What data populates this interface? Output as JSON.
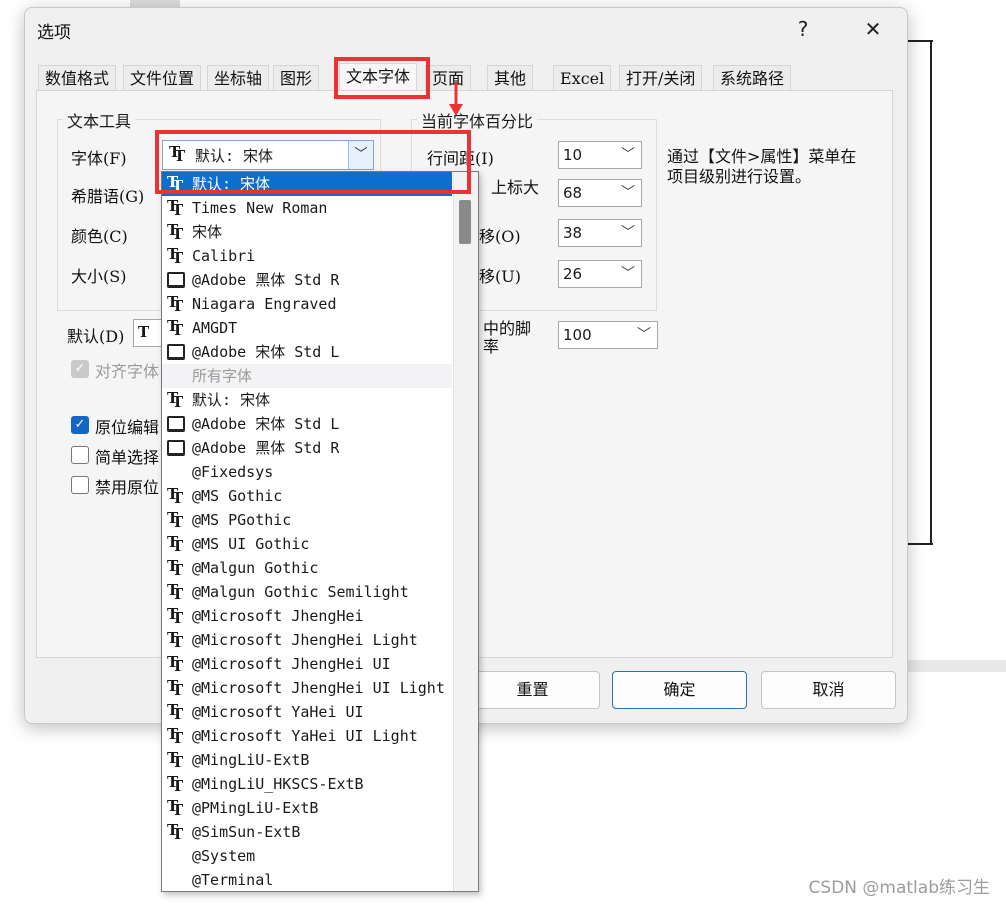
{
  "dialog": {
    "title": "选项",
    "help_label": "?",
    "close_label": "✕"
  },
  "tabs": [
    {
      "label": "数值格式"
    },
    {
      "label": "文件位置"
    },
    {
      "label": "坐标轴"
    },
    {
      "label": "图形"
    },
    {
      "label": "文本字体",
      "active": true
    },
    {
      "label": "页面"
    },
    {
      "label": "其他"
    },
    {
      "label": "Excel"
    },
    {
      "label": "打开/关闭"
    },
    {
      "label": "系统路径"
    }
  ],
  "text_tools": {
    "group_title": "文本工具",
    "font_label": "字体(F)",
    "font_value": "默认: 宋体",
    "greek_label": "希腊语(G)",
    "color_label": "颜色(C)",
    "size_label": "大小(S)"
  },
  "default_label": "默认(D)",
  "align_label": "对齐字体",
  "checkboxes": {
    "inplace_edit": "原位编辑",
    "simple_select": "简单选择",
    "disable_inplace": "禁用原位"
  },
  "font_percent": {
    "group_title": "当前字体百分比",
    "line_spacing_label": "行间距(I)",
    "line_spacing_value": "10",
    "superscript_label": "上标大",
    "superscript_value": "68",
    "offset1_label": "移(O)",
    "offset1_value": "38",
    "offset2_label": "移(U)",
    "offset2_value": "26",
    "footnote_label_1": "中的脚",
    "footnote_label_2": "率",
    "footnote_value": "100"
  },
  "info_text_1": "通过【文件>属性】菜单在",
  "info_text_2": "项目级别进行设置。",
  "buttons": {
    "reset": "重置",
    "ok": "确定",
    "cancel": "取消"
  },
  "dropdown": {
    "items": [
      {
        "label": "默认: 宋体",
        "icon": "truetype-icon",
        "selected": true
      },
      {
        "label": "Times New Roman",
        "icon": "truetype-icon"
      },
      {
        "label": "宋体",
        "icon": "truetype-icon"
      },
      {
        "label": "Calibri",
        "icon": "truetype-icon"
      },
      {
        "label": "@Adobe 黑体 Std R",
        "icon": "printer-font-icon"
      },
      {
        "label": "Niagara Engraved",
        "icon": "truetype-icon"
      },
      {
        "label": "AMGDT",
        "icon": "truetype-icon"
      },
      {
        "label": "@Adobe 宋体 Std L",
        "icon": "printer-font-icon"
      },
      {
        "label": "所有字体",
        "icon": "",
        "header": true
      },
      {
        "label": "默认: 宋体",
        "icon": "truetype-icon"
      },
      {
        "label": "@Adobe 宋体 Std L",
        "icon": "printer-font-icon"
      },
      {
        "label": "@Adobe 黑体 Std R",
        "icon": "printer-font-icon"
      },
      {
        "label": "@Fixedsys",
        "icon": ""
      },
      {
        "label": "@MS Gothic",
        "icon": "truetype-icon"
      },
      {
        "label": "@MS PGothic",
        "icon": "truetype-icon"
      },
      {
        "label": "@MS UI Gothic",
        "icon": "truetype-icon"
      },
      {
        "label": "@Malgun Gothic",
        "icon": "truetype-icon"
      },
      {
        "label": "@Malgun Gothic Semilight",
        "icon": "truetype-icon"
      },
      {
        "label": "@Microsoft JhengHei",
        "icon": "truetype-icon"
      },
      {
        "label": "@Microsoft JhengHei Light",
        "icon": "truetype-icon"
      },
      {
        "label": "@Microsoft JhengHei UI",
        "icon": "truetype-icon"
      },
      {
        "label": "@Microsoft JhengHei UI Light",
        "icon": "truetype-icon"
      },
      {
        "label": "@Microsoft YaHei UI",
        "icon": "truetype-icon"
      },
      {
        "label": "@Microsoft YaHei UI Light",
        "icon": "truetype-icon"
      },
      {
        "label": "@MingLiU-ExtB",
        "icon": "truetype-icon"
      },
      {
        "label": "@MingLiU_HKSCS-ExtB",
        "icon": "truetype-icon"
      },
      {
        "label": "@PMingLiU-ExtB",
        "icon": "truetype-icon"
      },
      {
        "label": "@SimSun-ExtB",
        "icon": "truetype-icon"
      },
      {
        "label": "@System",
        "icon": ""
      },
      {
        "label": "@Terminal",
        "icon": ""
      }
    ]
  },
  "colors": {
    "highlight_red": "#ec3333",
    "selection_blue": "#0b6fd0"
  },
  "watermark": "CSDN @matlab练习生"
}
